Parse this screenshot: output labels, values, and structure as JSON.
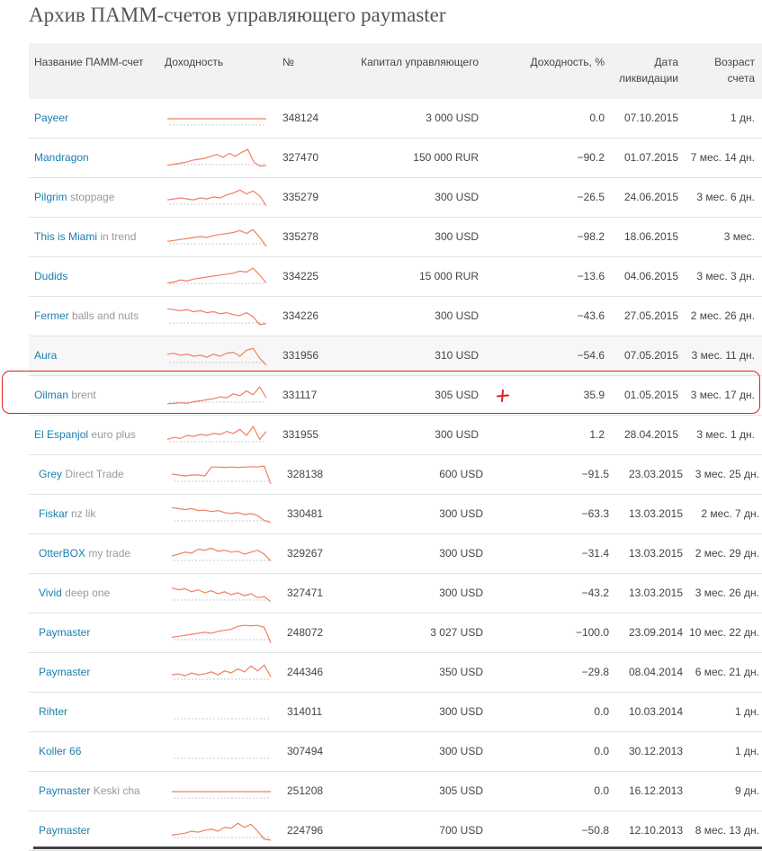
{
  "page": {
    "title": "Архив ПАММ-счетов управляющего paymaster"
  },
  "colors": {
    "link": "#1a7fae",
    "spark": "#f08060",
    "baseline": "#c8c8c8",
    "highlight": "#e02020"
  },
  "table": {
    "headers": {
      "name": "Название ПАММ-счет",
      "spark": "Доходность",
      "num": "№",
      "capital": "Капитал управляющего",
      "yield": "Доходность, %",
      "date_line1": "Дата",
      "date_line2": "ликвидации",
      "age_line1": "Возраст",
      "age_line2": "счета"
    },
    "rows": [
      {
        "name": "Payeer",
        "sub": "",
        "num": "348124",
        "capital": "3 000 USD",
        "yield": "0.0",
        "date": "07.10.2015",
        "age": "1 дн.",
        "spark": [
          0.5,
          0.5,
          0.5,
          0.5,
          0.5,
          0.5,
          0.5,
          0.5,
          0.5,
          0.5,
          0.5,
          0.5
        ]
      },
      {
        "name": "Mandragon",
        "sub": "",
        "num": "327470",
        "capital": "150 000 RUR",
        "yield": "−90.2",
        "date": "01.07.2015",
        "age": "7 мес. 14 дн.",
        "spark": [
          0.15,
          0.2,
          0.25,
          0.3,
          0.4,
          0.45,
          0.5,
          0.6,
          0.7,
          0.55,
          0.75,
          0.6,
          0.8,
          0.95,
          0.3,
          0.1,
          0.15
        ]
      },
      {
        "name": "Pilgrim",
        "sub": "stoppage",
        "num": "335279",
        "capital": "300 USD",
        "yield": "−26.5",
        "date": "24.06.2015",
        "age": "3 мес. 6 дн.",
        "spark": [
          0.4,
          0.45,
          0.5,
          0.45,
          0.4,
          0.5,
          0.45,
          0.55,
          0.5,
          0.65,
          0.75,
          0.9,
          0.7,
          0.85,
          0.6,
          0.1
        ]
      },
      {
        "name": "This is Miami",
        "sub": "in trend",
        "num": "335278",
        "capital": "300 USD",
        "yield": "−98.2",
        "date": "18.06.2015",
        "age": "3 мес.",
        "spark": [
          0.3,
          0.35,
          0.4,
          0.45,
          0.5,
          0.55,
          0.5,
          0.6,
          0.65,
          0.7,
          0.75,
          0.85,
          0.7,
          0.9,
          0.5,
          0.05
        ]
      },
      {
        "name": "Dudids",
        "sub": "",
        "num": "334225",
        "capital": "15 000 RUR",
        "yield": "−13.6",
        "date": "04.06.2015",
        "age": "3 мес. 3 дн.",
        "spark": [
          0.2,
          0.25,
          0.35,
          0.3,
          0.4,
          0.45,
          0.5,
          0.55,
          0.6,
          0.65,
          0.7,
          0.8,
          0.75,
          0.95,
          0.6,
          0.2
        ]
      },
      {
        "name": "Fermer",
        "sub": "balls and nuts",
        "num": "334226",
        "capital": "300 USD",
        "yield": "−43.6",
        "date": "27.05.2015",
        "age": "2 мес. 26 дн.",
        "spark": [
          0.9,
          0.85,
          0.8,
          0.85,
          0.75,
          0.8,
          0.7,
          0.75,
          0.65,
          0.7,
          0.6,
          0.55,
          0.7,
          0.5,
          0.1,
          0.15
        ]
      },
      {
        "name": "Aura",
        "sub": "",
        "num": "331956",
        "capital": "310 USD",
        "yield": "−54.6",
        "date": "07.05.2015",
        "age": "3 мес. 11 дн.",
        "spark": [
          0.6,
          0.65,
          0.55,
          0.6,
          0.5,
          0.55,
          0.45,
          0.6,
          0.5,
          0.65,
          0.7,
          0.5,
          0.8,
          0.9,
          0.4,
          0.05
        ]
      },
      {
        "name": "Oilman",
        "sub": "brent",
        "num": "331117",
        "capital": "305 USD",
        "yield": "35.9",
        "date": "01.05.2015",
        "age": "3 мес. 17 дн.",
        "spark": [
          0.1,
          0.12,
          0.15,
          0.12,
          0.2,
          0.25,
          0.3,
          0.35,
          0.45,
          0.4,
          0.6,
          0.5,
          0.75,
          0.55,
          0.95,
          0.4
        ]
      },
      {
        "name": "El Espanjol",
        "sub": "euro plus",
        "num": "331955",
        "capital": "300 USD",
        "yield": "1.2",
        "date": "28.04.2015",
        "age": "3 мес. 1 дн.",
        "spark": [
          0.3,
          0.4,
          0.35,
          0.5,
          0.45,
          0.55,
          0.5,
          0.6,
          0.55,
          0.7,
          0.6,
          0.8,
          0.5,
          0.95,
          0.3,
          0.7
        ]
      },
      {
        "name": "Grey",
        "sub": "Direct Trade",
        "num": "328138",
        "capital": "600 USD",
        "yield": "−91.5",
        "date": "23.03.2015",
        "age": "3 мес. 25 дн.",
        "spark": [
          0.55,
          0.5,
          0.45,
          0.5,
          0.5,
          0.45,
          0.9,
          0.9,
          0.88,
          0.9,
          0.88,
          0.9,
          0.92,
          0.9,
          0.95,
          0.05
        ]
      },
      {
        "name": "Fiskar",
        "sub": "nz lik",
        "num": "330481",
        "capital": "300 USD",
        "yield": "−63.3",
        "date": "13.03.2015",
        "age": "2 мес. 7 дн.",
        "spark": [
          0.85,
          0.8,
          0.75,
          0.8,
          0.7,
          0.72,
          0.65,
          0.7,
          0.6,
          0.55,
          0.6,
          0.5,
          0.55,
          0.45,
          0.2,
          0.1
        ]
      },
      {
        "name": "OtterBOX",
        "sub": "my trade",
        "num": "329267",
        "capital": "300 USD",
        "yield": "−31.4",
        "date": "13.03.2015",
        "age": "2 мес. 29 дн.",
        "spark": [
          0.4,
          0.5,
          0.6,
          0.55,
          0.75,
          0.7,
          0.8,
          0.65,
          0.7,
          0.6,
          0.65,
          0.5,
          0.6,
          0.7,
          0.5,
          0.15
        ]
      },
      {
        "name": "Vivid",
        "sub": "deep one",
        "num": "327471",
        "capital": "300 USD",
        "yield": "−43.2",
        "date": "13.03.2015",
        "age": "3 мес. 26 дн.",
        "spark": [
          0.8,
          0.7,
          0.75,
          0.6,
          0.7,
          0.55,
          0.65,
          0.5,
          0.6,
          0.45,
          0.55,
          0.4,
          0.5,
          0.3,
          0.35,
          0.1
        ]
      },
      {
        "name": "Paymaster",
        "sub": "",
        "num": "248072",
        "capital": "3 027 USD",
        "yield": "−100.0",
        "date": "23.09.2014",
        "age": "10 мес. 22 дн.",
        "spark": [
          0.3,
          0.35,
          0.4,
          0.45,
          0.5,
          0.55,
          0.5,
          0.6,
          0.65,
          0.7,
          0.85,
          0.9,
          0.88,
          0.9,
          0.8,
          0.02
        ]
      },
      {
        "name": "Paymaster",
        "sub": "",
        "num": "244346",
        "capital": "350 USD",
        "yield": "−29.8",
        "date": "08.04.2014",
        "age": "6 мес. 21 дн.",
        "spark": [
          0.4,
          0.45,
          0.35,
          0.5,
          0.4,
          0.45,
          0.55,
          0.4,
          0.6,
          0.5,
          0.7,
          0.55,
          0.85,
          0.6,
          0.9,
          0.3
        ]
      },
      {
        "name": "Rihter",
        "sub": "",
        "num": "314011",
        "capital": "300 USD",
        "yield": "0.0",
        "date": "10.03.2014",
        "age": "1 дн.",
        "spark": []
      },
      {
        "name": "Koller 66",
        "sub": "",
        "num": "307494",
        "capital": "300 USD",
        "yield": "0.0",
        "date": "30.12.2013",
        "age": "1 дн.",
        "spark": []
      },
      {
        "name": "Paymaster",
        "sub": "Keski cha",
        "num": "251208",
        "capital": "305 USD",
        "yield": "0.0",
        "date": "16.12.2013",
        "age": "9 дн.",
        "spark": [
          0.5,
          0.5,
          0.5,
          0.5,
          0.5,
          0.5,
          0.5,
          0.5,
          0.5,
          0.5,
          0.5,
          0.5
        ]
      },
      {
        "name": "Paymaster",
        "sub": "",
        "num": "224796",
        "capital": "700 USD",
        "yield": "−50.8",
        "date": "12.10.2013",
        "age": "8 мес. 13 дн.",
        "spark": [
          0.3,
          0.35,
          0.4,
          0.5,
          0.45,
          0.55,
          0.6,
          0.5,
          0.7,
          0.65,
          0.9,
          0.7,
          0.85,
          0.5,
          0.1,
          0.05
        ]
      }
    ]
  }
}
